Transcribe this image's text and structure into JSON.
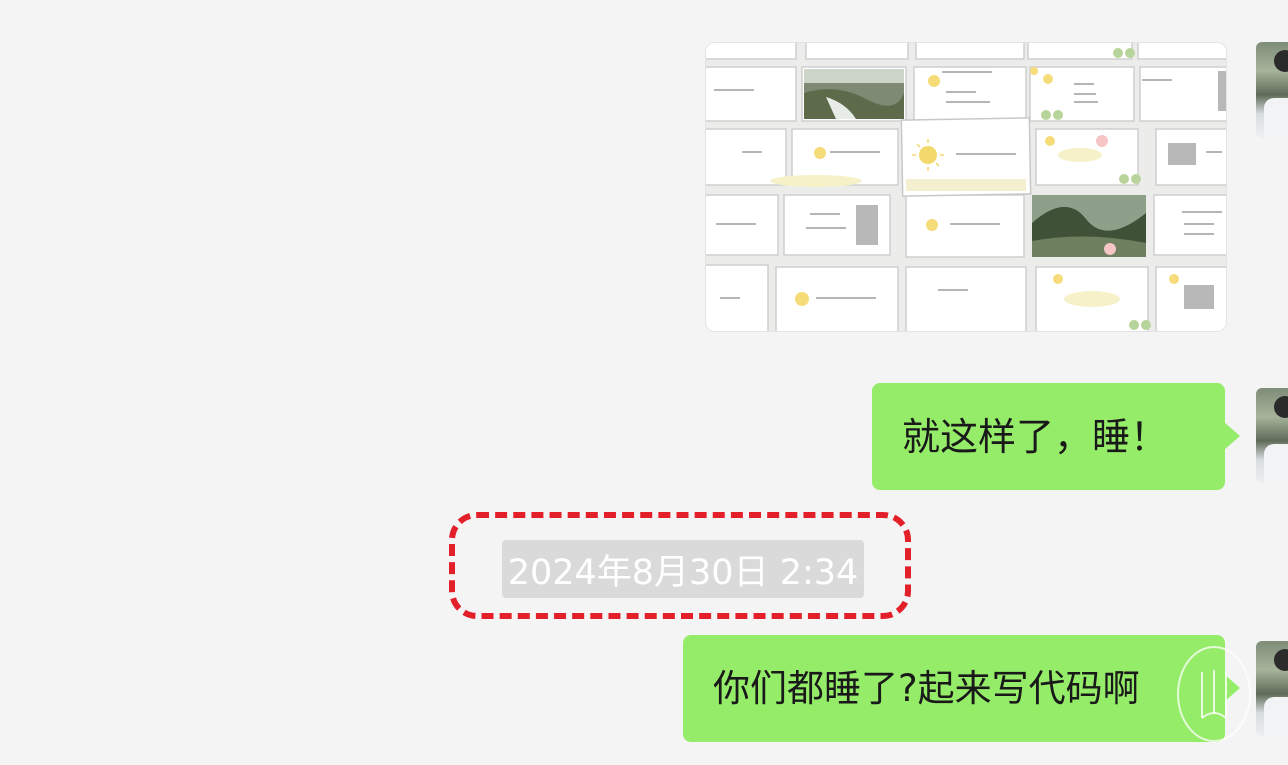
{
  "chat": {
    "image_message": {
      "sender": "self",
      "caption": "PPT slides preview"
    },
    "messages": [
      {
        "sender": "self",
        "text": "就这样了，睡！"
      },
      {
        "sender": "self",
        "text": "你们都睡了?起来写代码啊"
      }
    ],
    "timestamp": "2024年8月30日 2:34"
  },
  "colors": {
    "background": "#f4f4f4",
    "bubble_self": "#95ec69",
    "timestamp_bg": "#dadada",
    "highlight": "#e3202a"
  },
  "icons": {
    "avatar": "user-avatar",
    "watermark": "watermark-seal"
  }
}
